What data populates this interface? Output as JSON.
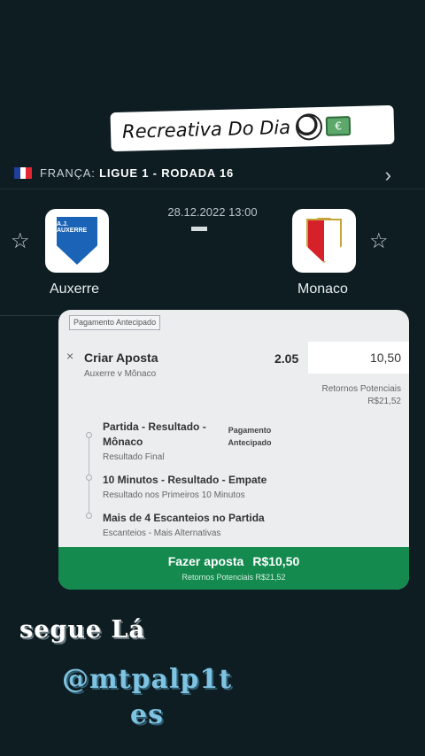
{
  "sticker": {
    "text": "Recreativa Do Dia",
    "bill_symbol": "€",
    "icons": [
      "soccer-ball-icon",
      "money-bill-icon"
    ]
  },
  "league": {
    "country": "FRANÇA:",
    "name": "LIGUE 1 - RODADA 16",
    "flag_colors": [
      "#1f3f9c",
      "#ffffff",
      "#e32631"
    ],
    "chevron": "›"
  },
  "match": {
    "datetime": "28.12.2022 13:00",
    "home": {
      "name": "Auxerre",
      "crest_text": "A.J. AUXERRE"
    },
    "away": {
      "name": "Monaco"
    },
    "star": "☆"
  },
  "slip": {
    "tag": "Pagamento Antecipado",
    "close": "×",
    "title": "Criar Aposta",
    "subtitle": "Auxerre v Mônaco",
    "odds": "2.05",
    "stake": "10,50",
    "returns_label": "Retornos Potenciais",
    "returns_value": "R$21,52",
    "badge_line1": "Pagamento",
    "badge_line2": "Antecipado",
    "selections": [
      {
        "title1": "Partida - Resultado -",
        "title2": "Mônaco",
        "sub": "Resultado Final"
      },
      {
        "title1": "10 Minutos - Resultado - Empate",
        "sub": "Resultado nos Primeiros 10 Minutos"
      },
      {
        "title1": "Mais de 4 Escanteios no Partida",
        "sub": "Escanteios - Mais Alternativas"
      }
    ],
    "button_label": "Fazer aposta",
    "button_amount": "R$10,50",
    "button_sub": "Retornos Potenciais R$21,52"
  },
  "promo": {
    "line1": "segue Lá",
    "line2": "@mtpalp1t",
    "line3": "es"
  },
  "colors": {
    "background": "#0e1d22",
    "button": "#148a4f",
    "promo_handle": "#7ec3e2"
  }
}
